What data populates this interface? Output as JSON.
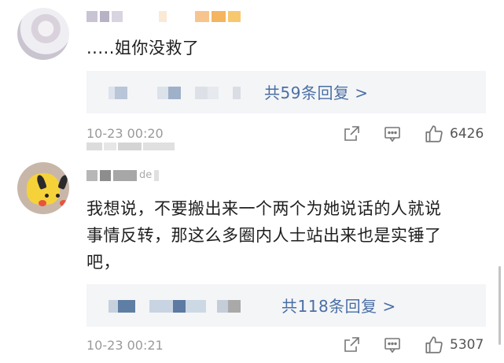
{
  "comments": [
    {
      "text": ".....姐你没救了",
      "reply_link": "共59条回复 >",
      "time": "10-23 00:20",
      "like_count": "6426"
    },
    {
      "username_partial": "de",
      "text_lines": [
        "我想说，不要搬出来一个两个为她说话的人就说",
        "事情反转，那这么多圈内人士站出来也是实锤了",
        "吧，"
      ],
      "reply_link": "共118条回复 >",
      "time": "10-23 00:21",
      "like_count": "5307"
    }
  ],
  "icons": {
    "share": "share-icon",
    "comment": "comment-icon",
    "like": "thumbs-up-icon"
  },
  "colors": {
    "link": "#4a6fa5",
    "meta": "#9a9a9a",
    "reply_bg": "#f4f5f7"
  }
}
